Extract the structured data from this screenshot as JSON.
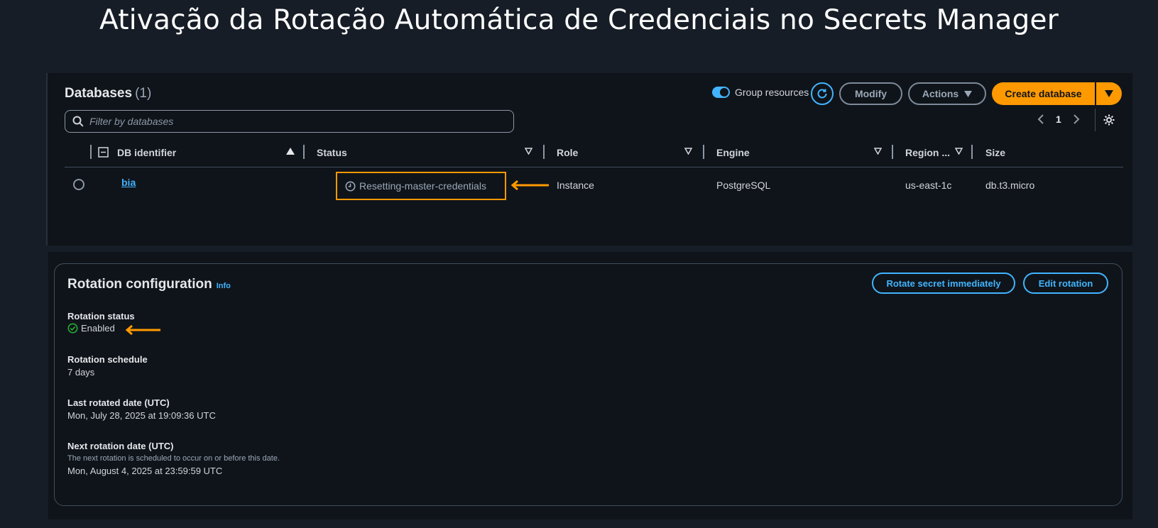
{
  "page_title": "Ativação da Rotação Automática de Credenciais no Secrets Manager",
  "databases": {
    "heading": "Databases",
    "count": "(1)",
    "group_resources_label": "Group resources",
    "modify_label": "Modify",
    "actions_label": "Actions",
    "create_label": "Create database",
    "search_placeholder": "Filter by databases",
    "page_number": "1",
    "columns": {
      "db_identifier": "DB identifier",
      "status": "Status",
      "role": "Role",
      "engine": "Engine",
      "region": "Region ...",
      "size": "Size"
    },
    "row": {
      "db_identifier": "bia",
      "status": "Resetting-master-credentials",
      "role": "Instance",
      "engine": "PostgreSQL",
      "region": "us-east-1c",
      "size": "db.t3.micro"
    }
  },
  "rotation": {
    "title": "Rotation configuration",
    "info_label": "Info",
    "rotate_now_label": "Rotate secret immediately",
    "edit_label": "Edit rotation",
    "status_label": "Rotation status",
    "status_value": "Enabled",
    "schedule_label": "Rotation schedule",
    "schedule_value": "7 days",
    "last_label": "Last rotated date (UTC)",
    "last_value": "Mon, July 28, 2025 at 19:09:36 UTC",
    "next_label": "Next rotation date (UTC)",
    "next_desc": "The next rotation is scheduled to occur on or before this date.",
    "next_value": "Mon, August 4, 2025 at 23:59:59 UTC"
  },
  "colors": {
    "accent_orange": "#ff9900",
    "link_blue": "#42b4ff",
    "success_green": "#29ad32",
    "background": "#161d26",
    "panel": "#0f141a"
  },
  "icons": [
    "search-icon",
    "refresh-icon",
    "caret-down-icon",
    "chevron-left-icon",
    "chevron-right-icon",
    "settings-gear-icon",
    "collapse-icon",
    "sort-ascending-icon",
    "sort-descending-icon",
    "clock-icon",
    "check-circle-icon",
    "arrow-left-icon"
  ]
}
